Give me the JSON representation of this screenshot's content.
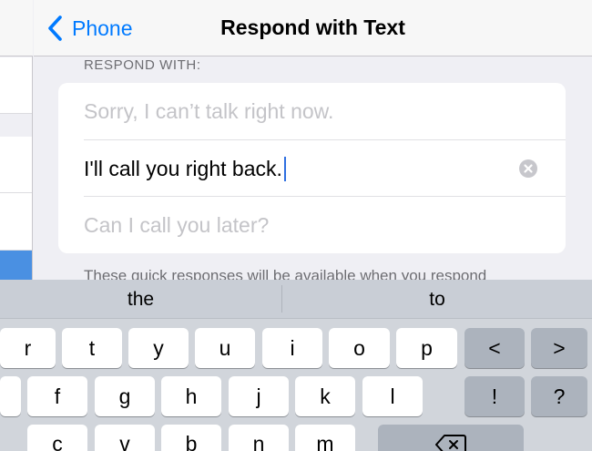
{
  "nav": {
    "back_label": "Phone",
    "title": "Respond with Text"
  },
  "section": {
    "header": "RESPOND WITH:",
    "footer": "These quick responses will be available when you respond"
  },
  "responses": [
    {
      "placeholder": "Sorry, I can’t talk right now.",
      "value": ""
    },
    {
      "placeholder": "",
      "value": "I'll call you right back."
    },
    {
      "placeholder": "Can I call you later?",
      "value": ""
    }
  ],
  "keyboard": {
    "suggestions": [
      "the",
      "to"
    ],
    "row1": [
      "r",
      "t",
      "y",
      "u",
      "i",
      "o",
      "p",
      "<",
      ">"
    ],
    "row2": [
      "f",
      "g",
      "h",
      "j",
      "k",
      "l",
      "!",
      "?"
    ],
    "row3": [
      "c",
      "v",
      "b",
      "n",
      "m"
    ]
  }
}
